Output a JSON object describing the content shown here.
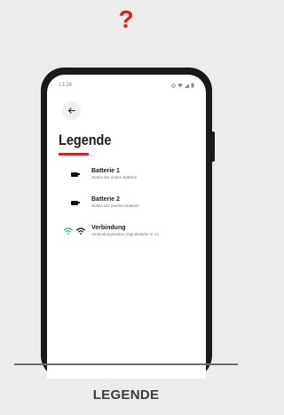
{
  "header": {
    "question_mark": "?"
  },
  "phone": {
    "status_bar": {
      "time": "13:26"
    },
    "back_icon": "arrow-left-icon",
    "title": "Legende",
    "accent_color": "#d61f26",
    "legend": [
      {
        "icon": "battery-icon",
        "label": "Batterie 1",
        "description": "Status der ersten Batterie"
      },
      {
        "icon": "battery-icon",
        "label": "Batterie 2",
        "description": "Status der zweiten Batterie"
      },
      {
        "icon": "wifi-icon",
        "label": "Verbindung",
        "description": "Verbindungsstatus (Signalstärke in %)"
      }
    ]
  },
  "caption": "LEGENDE"
}
